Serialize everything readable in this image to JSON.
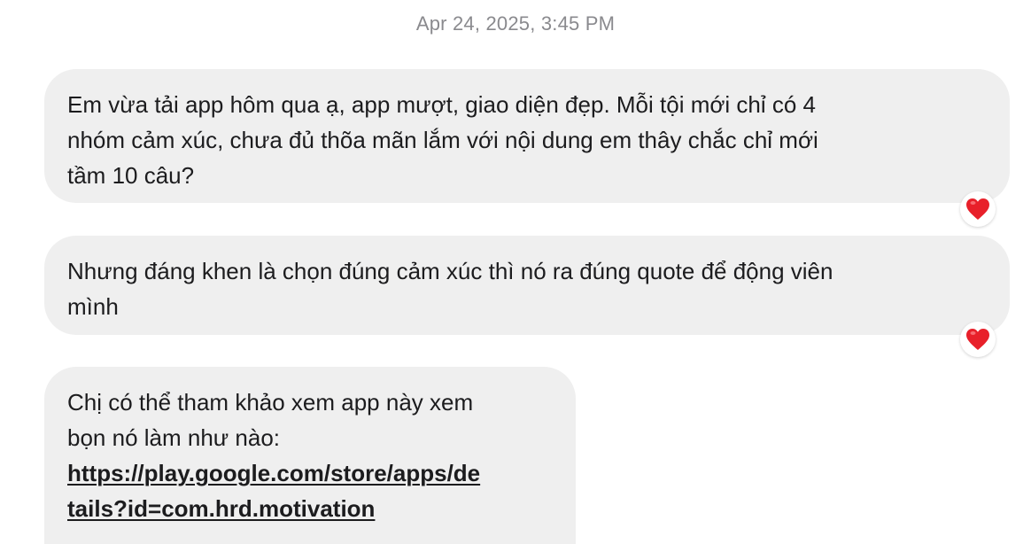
{
  "conversation": {
    "timestamp": "Apr 24, 2025, 3:45 PM",
    "messages": [
      {
        "lines": [
          "Em vừa tải app hôm qua ạ, app mượt, giao diện đẹp. Mỗi tội mới chỉ có 4",
          "nhóm cảm xúc, chưa đủ thõa mãn lắm với nội dung em thây chắc chỉ mới",
          "tầm 10 câu?"
        ],
        "reaction": "heart-icon"
      },
      {
        "lines": [
          "Nhưng đáng khen là chọn đúng cảm xúc thì nó ra đúng quote để động viên",
          "mình"
        ],
        "reaction": "heart-icon"
      },
      {
        "lines": [
          "Chị có thể tham khảo xem app này xem",
          "bọn nó làm như nào:"
        ],
        "link_lines": [
          "https://play.google.com/store/apps/de",
          "tails?id=com.hrd.motivation"
        ]
      }
    ]
  },
  "colors": {
    "bubble": "#efefef",
    "heart": "#e8202a",
    "timestamp": "#8a8a8e"
  }
}
